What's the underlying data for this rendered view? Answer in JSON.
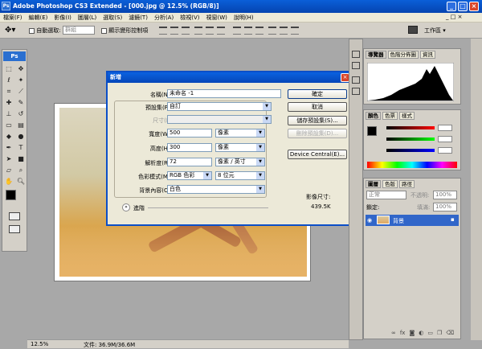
{
  "titlebar": {
    "title": "Adobe Photoshop CS3 Extended - [000.jpg @ 12.5% (RGB/8)]",
    "ps_logo": "Ps"
  },
  "menubar": {
    "items": [
      "檔案(F)",
      "編輯(E)",
      "影像(I)",
      "圖層(L)",
      "選取(S)",
      "濾鏡(T)",
      "分析(A)",
      "檢視(V)",
      "視窗(W)",
      "說明(H)"
    ]
  },
  "options": {
    "auto_select_label": "自動選取:",
    "auto_select_value": "群組",
    "show_transform_label": "顯示變形控制項",
    "workspace_label": "工作區"
  },
  "tools": {
    "ps_label": "Ps"
  },
  "dialog": {
    "title": "新增",
    "name_label": "名稱(N):",
    "name_value": "未命名 -1",
    "preset_label": "預設集(P):",
    "preset_value": "自訂",
    "size_label": "尺寸(I):",
    "width_label": "寬度(W):",
    "width_value": "500",
    "width_unit": "像素",
    "height_label": "高度(H):",
    "height_value": "300",
    "height_unit": "像素",
    "resolution_label": "解析度(R):",
    "resolution_value": "72",
    "resolution_unit": "像素 / 英寸",
    "mode_label": "色彩模式(M):",
    "mode_value": "RGB 色彩",
    "bits_value": "8 位元",
    "bg_label": "背景內容(C):",
    "bg_value": "白色",
    "advanced_label": "進階",
    "ok_label": "確定",
    "cancel_label": "取消",
    "save_preset_label": "儲存預設集(S)...",
    "delete_preset_label": "刪除預設集(D)...",
    "device_central_label": "Device Central(E)...",
    "image_size_label": "影像尺寸:",
    "image_size_value": "439.5K"
  },
  "statusbar": {
    "zoom": "12.5%",
    "doc": "文件: 36.9M/36.6M"
  },
  "panels": {
    "top_tabs": [
      "導覽器",
      "色階分佈圖",
      "資訊"
    ],
    "color_tabs": [
      "顏色",
      "色票",
      "樣式"
    ],
    "layers_tabs": [
      "圖層",
      "色版",
      "路徑"
    ],
    "blend_mode": "正常",
    "opacity_label": "不透明:",
    "opacity_value": "100%",
    "lock_label": "鎖定:",
    "fill_label": "填滿:",
    "fill_value": "100%",
    "layer_name": "背景"
  },
  "colors": {
    "accent": "#0a5fd8",
    "layer_selected": "#3166c9"
  }
}
